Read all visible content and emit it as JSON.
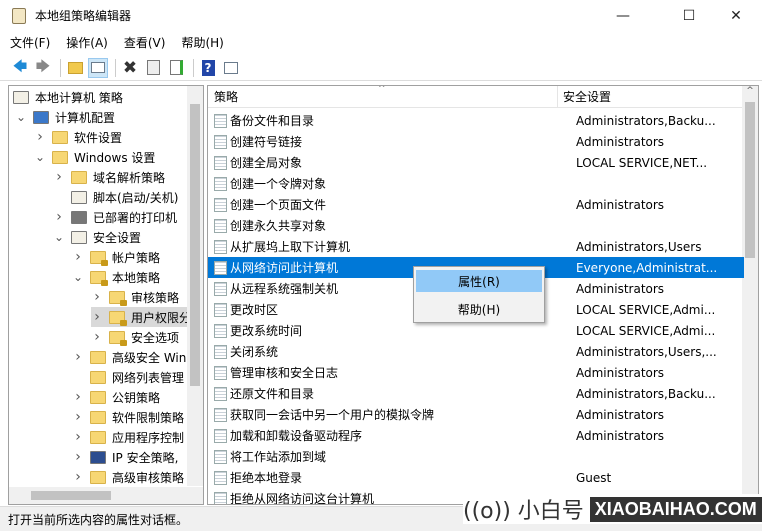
{
  "window": {
    "title": "本地组策略编辑器",
    "minimize": "—",
    "maximize": "☐",
    "close": "✕"
  },
  "menu": [
    "文件(F)",
    "操作(A)",
    "查看(V)",
    "帮助(H)"
  ],
  "toolbar": [
    "back-icon",
    "forward-icon",
    "up-folder-icon",
    "show-hide-tree-icon",
    "delete-icon",
    "properties-icon",
    "export-list-icon",
    "help-icon",
    "show-hide-action-pane-icon"
  ],
  "tree": [
    {
      "label": "本地计算机 策略",
      "level": 0,
      "chevron": "",
      "icon": "policy"
    },
    {
      "label": "计算机配置",
      "level": 0,
      "chevron": "v",
      "icon": "computer"
    },
    {
      "label": "软件设置",
      "level": 1,
      "chevron": ">",
      "icon": "folder"
    },
    {
      "label": "Windows 设置",
      "level": 1,
      "chevron": "v",
      "icon": "folder"
    },
    {
      "label": "域名解析策略",
      "level": 2,
      "chevron": ">",
      "icon": "folder"
    },
    {
      "label": "脚本(启动/关机)",
      "level": 2,
      "chevron": "",
      "icon": "script"
    },
    {
      "label": "已部署的打印机",
      "level": 2,
      "chevron": ">",
      "icon": "printer"
    },
    {
      "label": "安全设置",
      "level": 2,
      "chevron": "v",
      "icon": "security"
    },
    {
      "label": "帐户策略",
      "level": 3,
      "chevron": ">",
      "icon": "lockfolder"
    },
    {
      "label": "本地策略",
      "level": 3,
      "chevron": "v",
      "icon": "lockfolder"
    },
    {
      "label": "审核策略",
      "level": 4,
      "chevron": ">",
      "icon": "lockfolder"
    },
    {
      "label": "用户权限分",
      "level": 4,
      "chevron": ">",
      "icon": "lockfolder",
      "selected": true
    },
    {
      "label": "安全选项",
      "level": 4,
      "chevron": ">",
      "icon": "lockfolder"
    },
    {
      "label": "高级安全 Win",
      "level": 3,
      "chevron": ">",
      "icon": "folder"
    },
    {
      "label": "网络列表管理",
      "level": 3,
      "chevron": "",
      "icon": "folder"
    },
    {
      "label": "公钥策略",
      "level": 3,
      "chevron": ">",
      "icon": "folder"
    },
    {
      "label": "软件限制策略",
      "level": 3,
      "chevron": ">",
      "icon": "folder"
    },
    {
      "label": "应用程序控制",
      "level": 3,
      "chevron": ">",
      "icon": "folder"
    },
    {
      "label": "IP 安全策略,",
      "level": 3,
      "chevron": ">",
      "icon": "ipsec"
    },
    {
      "label": "高级审核策略",
      "level": 3,
      "chevron": ">",
      "icon": "folder"
    }
  ],
  "list": {
    "headers": [
      "策略",
      "安全设置"
    ],
    "rows": [
      [
        "备份文件和目录",
        "Administrators,Backu..."
      ],
      [
        "创建符号链接",
        "Administrators"
      ],
      [
        "创建全局对象",
        "LOCAL SERVICE,NET..."
      ],
      [
        "创建一个令牌对象",
        ""
      ],
      [
        "创建一个页面文件",
        "Administrators"
      ],
      [
        "创建永久共享对象",
        ""
      ],
      [
        "从扩展坞上取下计算机",
        "Administrators,Users"
      ],
      [
        "从网络访问此计算机",
        "Everyone,Administrat..."
      ],
      [
        "从远程系统强制关机",
        "Administrators"
      ],
      [
        "更改时区",
        "LOCAL SERVICE,Admi..."
      ],
      [
        "更改系统时间",
        "LOCAL SERVICE,Admi..."
      ],
      [
        "关闭系统",
        "Administrators,Users,..."
      ],
      [
        "管理审核和安全日志",
        "Administrators"
      ],
      [
        "还原文件和目录",
        "Administrators,Backu..."
      ],
      [
        "获取同一会话中另一个用户的模拟令牌",
        "Administrators"
      ],
      [
        "加载和卸载设备驱动程序",
        "Administrators"
      ],
      [
        "将工作站添加到域",
        ""
      ],
      [
        "拒绝本地登录",
        "Guest"
      ],
      [
        "拒绝从网络访问这台计算机",
        ""
      ]
    ],
    "selected_index": 7
  },
  "context_menu": [
    "属性(R)",
    "帮助(H)"
  ],
  "status": "打开当前所选内容的属性对话框。",
  "watermark": {
    "brand": "((o)) 小白号",
    "site": "XIAOBAIHAO.COM"
  },
  "colors": {
    "selection": "#0078d7",
    "menu_highlight": "#91c9f7"
  }
}
